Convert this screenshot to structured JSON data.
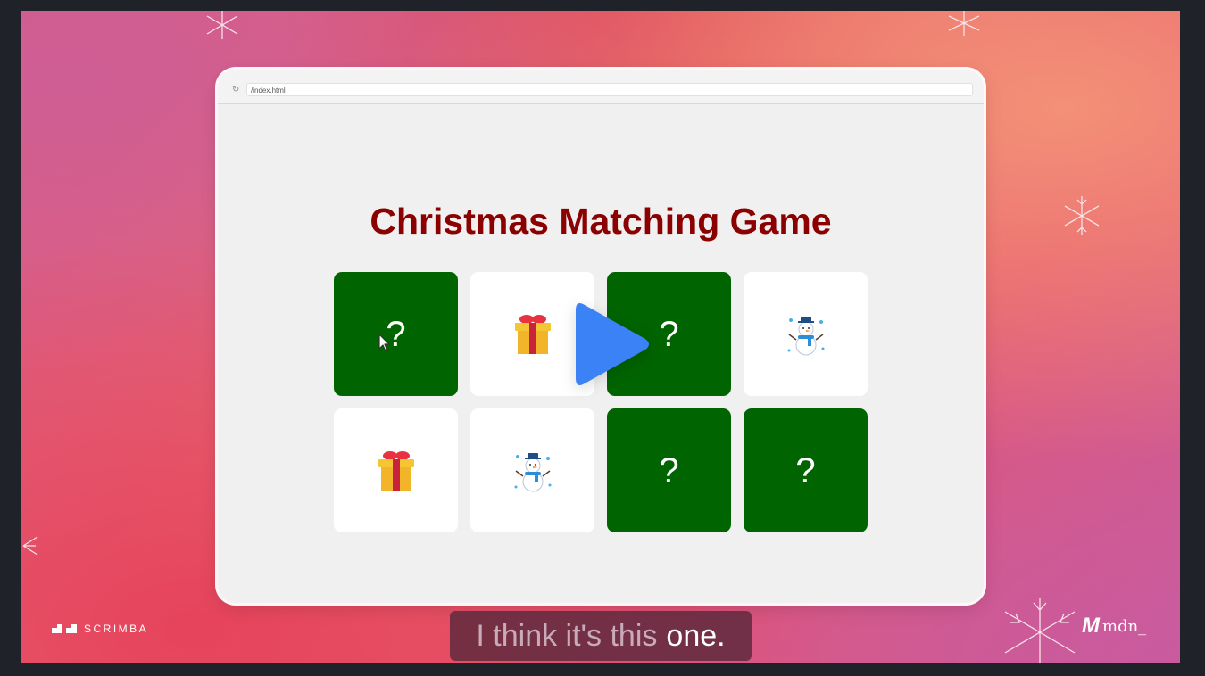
{
  "browser": {
    "url": "/index.html",
    "reload_icon": "reload-icon"
  },
  "game": {
    "title": "Christmas Matching Game",
    "cards": [
      {
        "state": "hidden",
        "label": "?"
      },
      {
        "state": "revealed",
        "icon": "gift-icon"
      },
      {
        "state": "hidden",
        "label": "?"
      },
      {
        "state": "revealed",
        "icon": "snowman-icon"
      },
      {
        "state": "revealed",
        "icon": "gift-icon"
      },
      {
        "state": "revealed",
        "icon": "snowman-icon"
      },
      {
        "state": "hidden",
        "label": "?"
      },
      {
        "state": "hidden",
        "label": "?"
      }
    ]
  },
  "player": {
    "play_icon": "play-icon",
    "subtitle": {
      "dim": "I think it's this",
      "bright": "one."
    }
  },
  "branding": {
    "scrimba": "SCRIMBA",
    "mdn_mark": "M",
    "mdn": "mdn_"
  },
  "colors": {
    "card_hidden": "#006400",
    "card_revealed": "#ffffff",
    "title": "#8b0000",
    "play_button": "#3b82f6"
  }
}
